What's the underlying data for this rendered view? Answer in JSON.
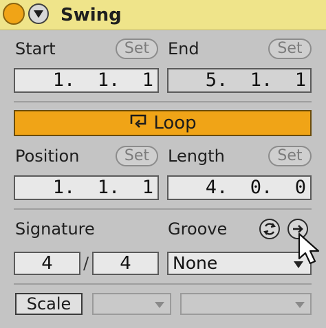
{
  "header": {
    "title": "Swing",
    "fold_icon": "activator-circle-icon",
    "menu_icon": "triangle-down-icon",
    "accent_color": "#f0a417",
    "bar_color": "#efe48a"
  },
  "start": {
    "label": "Start",
    "set_label": "Set",
    "value": "1.  1.  1"
  },
  "end": {
    "label": "End",
    "set_label": "Set",
    "value": "5.  1.  1"
  },
  "loop": {
    "label": "Loop",
    "icon": "loop-icon",
    "active_color": "#f0a417"
  },
  "position": {
    "label": "Position",
    "set_label": "Set",
    "value": "1.  1.  1"
  },
  "length": {
    "label": "Length",
    "set_label": "Set",
    "value": "4.  0.  0"
  },
  "signature": {
    "label": "Signature",
    "numerator": "4",
    "separator": "/",
    "denominator": "4"
  },
  "groove": {
    "label": "Groove",
    "value": "None",
    "commit_icon": "groove-commit-icon",
    "hot_swap_icon": "hot-swap-icon"
  },
  "scale": {
    "label": "Scale"
  },
  "cursor": {
    "icon": "mouse-pointer-icon"
  }
}
